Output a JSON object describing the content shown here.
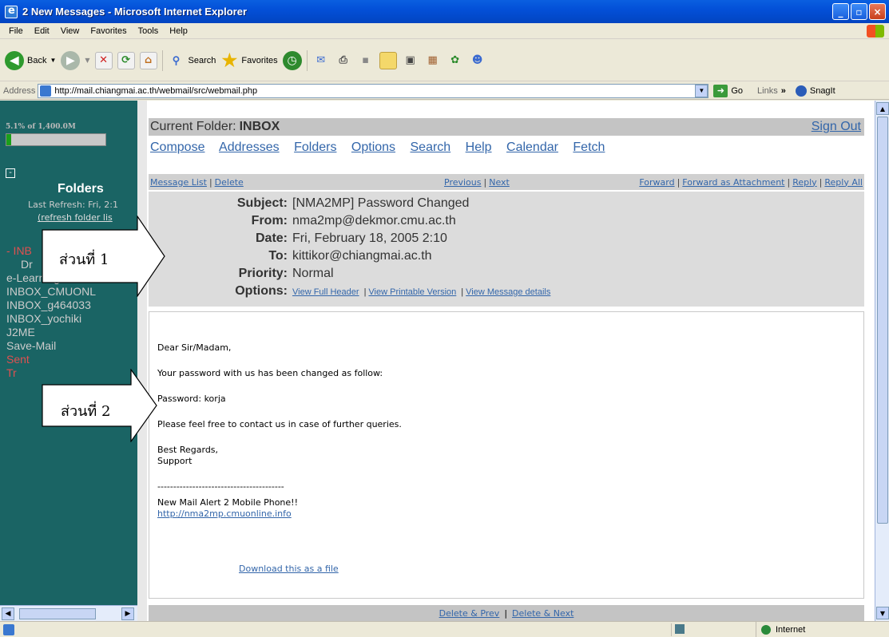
{
  "window": {
    "title": "2 New Messages - Microsoft Internet Explorer",
    "controls": [
      "_",
      "▫",
      "×"
    ]
  },
  "menu": [
    "File",
    "Edit",
    "View",
    "Favorites",
    "Tools",
    "Help"
  ],
  "toolbar": {
    "back": "Back",
    "search": "Search",
    "favorites": "Favorites"
  },
  "address": {
    "label": "Address",
    "url": "http://mail.chiangmai.ac.th/webmail/src/webmail.php",
    "go": "Go",
    "links": "Links",
    "snagit": "SnagIt"
  },
  "sidebar": {
    "quota_text": "5.1% of 1,400.0M",
    "quota_fraction": 0.051,
    "collapse": "-",
    "folders_title": "Folders",
    "last_refresh": "Last Refresh: Fri, 2:1",
    "refresh_link": "(refresh folder lis",
    "folders": [
      {
        "name": "- INB",
        "red": true,
        "indent": false
      },
      {
        "name": "Dr",
        "red": false,
        "indent": true
      },
      {
        "name": "e-Learning",
        "red": false,
        "indent": false
      },
      {
        "name": "INBOX_CMUONL",
        "red": false,
        "indent": false
      },
      {
        "name": "INBOX_g464033",
        "red": false,
        "indent": false
      },
      {
        "name": "INBOX_yochiki",
        "red": false,
        "indent": false
      },
      {
        "name": "J2ME",
        "red": false,
        "indent": false
      },
      {
        "name": "Save-Mail",
        "red": false,
        "indent": false
      },
      {
        "name": "Sent",
        "red": true,
        "indent": false
      },
      {
        "name": "Tr",
        "red": true,
        "indent": false
      }
    ]
  },
  "mail": {
    "current_folder_label": "Current Folder:",
    "current_folder": "INBOX",
    "sign_out": "Sign Out",
    "nav": [
      "Compose",
      "Addresses",
      "Folders",
      "Options",
      "Search",
      "Help",
      "Calendar",
      "Fetch"
    ],
    "actions_left": [
      "Message List",
      "Delete"
    ],
    "actions_mid": [
      "Previous",
      "Next"
    ],
    "actions_right": [
      "Forward",
      "Forward as Attachment",
      "Reply",
      "Reply All"
    ],
    "headers": {
      "subject_k": "Subject:",
      "subject": "[NMA2MP] Password Changed",
      "from_k": "From:",
      "from": "nma2mp@dekmor.cmu.ac.th",
      "date_k": "Date:",
      "date": "Fri, February 18, 2005 2:10",
      "to_k": "To:",
      "to": "kittikor@chiangmai.ac.th",
      "priority_k": "Priority:",
      "priority": "Normal",
      "options_k": "Options:",
      "options": [
        "View Full Header",
        "View Printable Version",
        "View Message details"
      ]
    },
    "body": {
      "greeting": "Dear Sir/Madam,",
      "line1": "Your password with us has been changed as follow:",
      "line2": "Password: korja",
      "line3": "Please feel free to contact us in case of further queries.",
      "regards": "Best Regards,",
      "support": "Support",
      "separator": "----------------------------------------",
      "alert": "New Mail Alert 2 Mobile Phone!!",
      "link": "http://nma2mp.cmuonline.info",
      "download": "Download this as a file"
    },
    "bottom": [
      "Delete & Prev",
      "Delete & Next"
    ]
  },
  "callouts": {
    "part1": "ส่วนที่ 1",
    "part2": "ส่วนที่ 2"
  },
  "status": {
    "zone": "Internet"
  }
}
